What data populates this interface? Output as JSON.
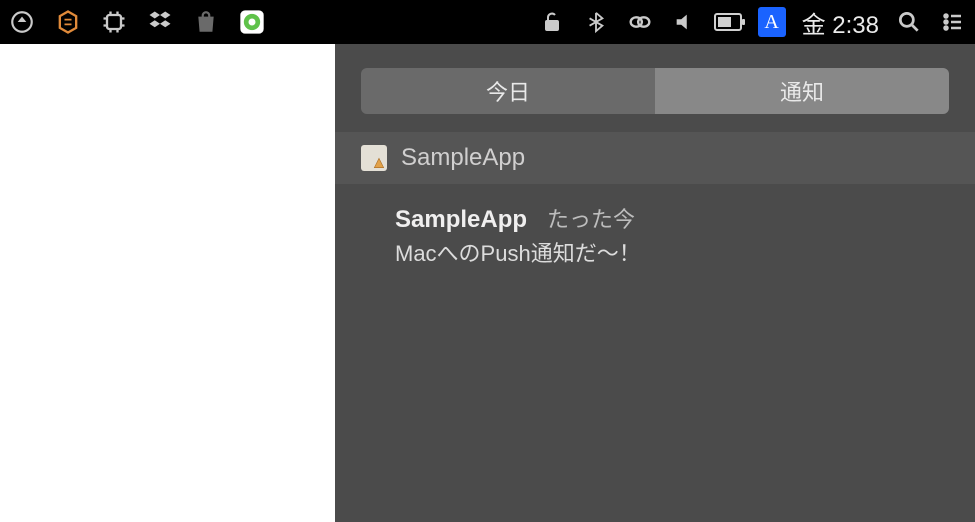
{
  "menubar": {
    "clock": "金 2:38",
    "input_badge": "A"
  },
  "notification_center": {
    "tabs": {
      "today": "今日",
      "notifications": "通知"
    },
    "app_section": {
      "name": "SampleApp"
    },
    "notifications": [
      {
        "title": "SampleApp",
        "timestamp": "たった今",
        "body": "MacへのPush通知だ〜！"
      }
    ]
  }
}
